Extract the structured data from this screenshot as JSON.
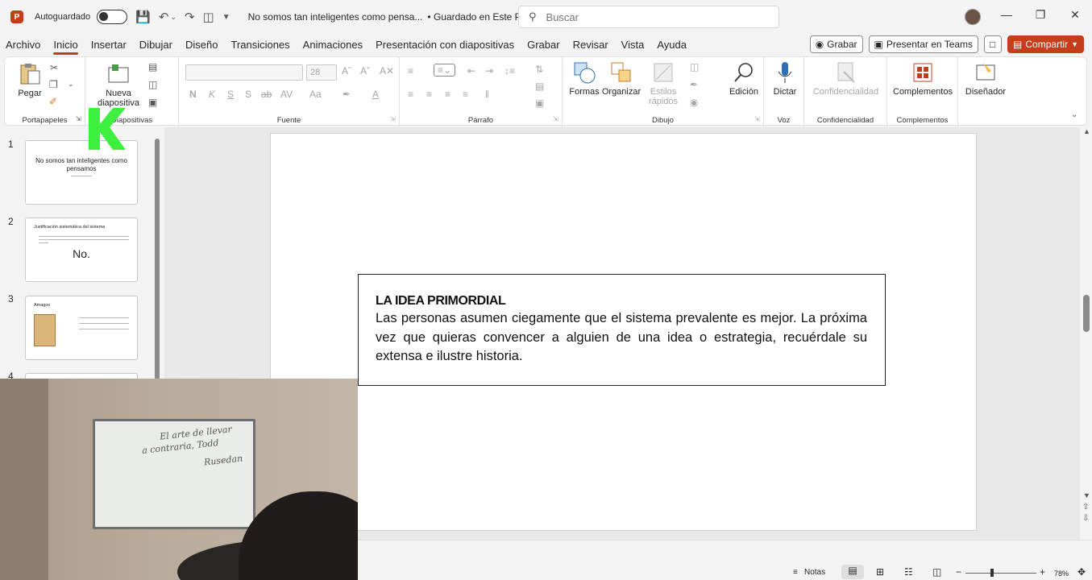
{
  "titlebar": {
    "autosave_label": "Autoguardado",
    "doc_title": "No somos tan inteligentes como pensa...",
    "doc_status": "• Guardado en Este PC",
    "search_placeholder": "Buscar"
  },
  "menu": {
    "tabs": [
      "Archivo",
      "Inicio",
      "Insertar",
      "Dibujar",
      "Diseño",
      "Transiciones",
      "Animaciones",
      "Presentación con diapositivas",
      "Grabar",
      "Revisar",
      "Vista",
      "Ayuda"
    ],
    "active": "Inicio",
    "record_label": "Grabar",
    "teams_label": "Presentar en Teams",
    "share_label": "Compartir"
  },
  "ribbon": {
    "groups": {
      "portapapeles": "Portapapeles",
      "diapositivas": "Diapositivas",
      "fuente": "Fuente",
      "parrafo": "Párrafo",
      "dibujo": "Dibujo",
      "voz": "Voz",
      "confidencialidad": "Confidencialidad",
      "complementos": "Complementos"
    },
    "paste_label": "Pegar",
    "new_slide_label_1": "Nueva",
    "new_slide_label_2": "diapositiva",
    "font_size": "28",
    "formas_label": "Formas",
    "organizar_label": "Organizar",
    "estilos_label_1": "Estilos",
    "estilos_label_2": "rápidos",
    "edicion_label": "Edición",
    "dictar_label": "Dictar",
    "confidencialidad_label": "Confidencialidad",
    "complementos_label": "Complementos",
    "disenador_label": "Diseñador",
    "font_buttons": [
      "N",
      "K",
      "S",
      "S",
      "ab",
      "AV",
      "Aa"
    ]
  },
  "thumbnails": [
    {
      "num": "1",
      "title": "No somos tan inteligentes como pensamos"
    },
    {
      "num": "2",
      "title": "Justificación sistemática del sistema",
      "big": "No."
    },
    {
      "num": "3",
      "title": "Amagos"
    },
    {
      "num": "4"
    }
  ],
  "slide": {
    "heading": "LA IDEA PRIMORDIAL",
    "body": "Las personas asumen ciegamente que el sistema prevalente es mejor. La próxima vez que quieras convencer a alguien de una idea o estrategia, recuérdale su extensa e ilustre historia."
  },
  "statusbar": {
    "notes_label": "Notas",
    "zoom_minus": "−",
    "zoom_plus": "+",
    "zoom": "78%"
  },
  "webcam": {
    "whiteboard_line1": "El arte de llevar",
    "whiteboard_line2": "a contraria, Todd",
    "whiteboard_line3": "Rusedan"
  },
  "colors": {
    "accent": "#c43e1c",
    "overlay_green": "#3df03d"
  }
}
